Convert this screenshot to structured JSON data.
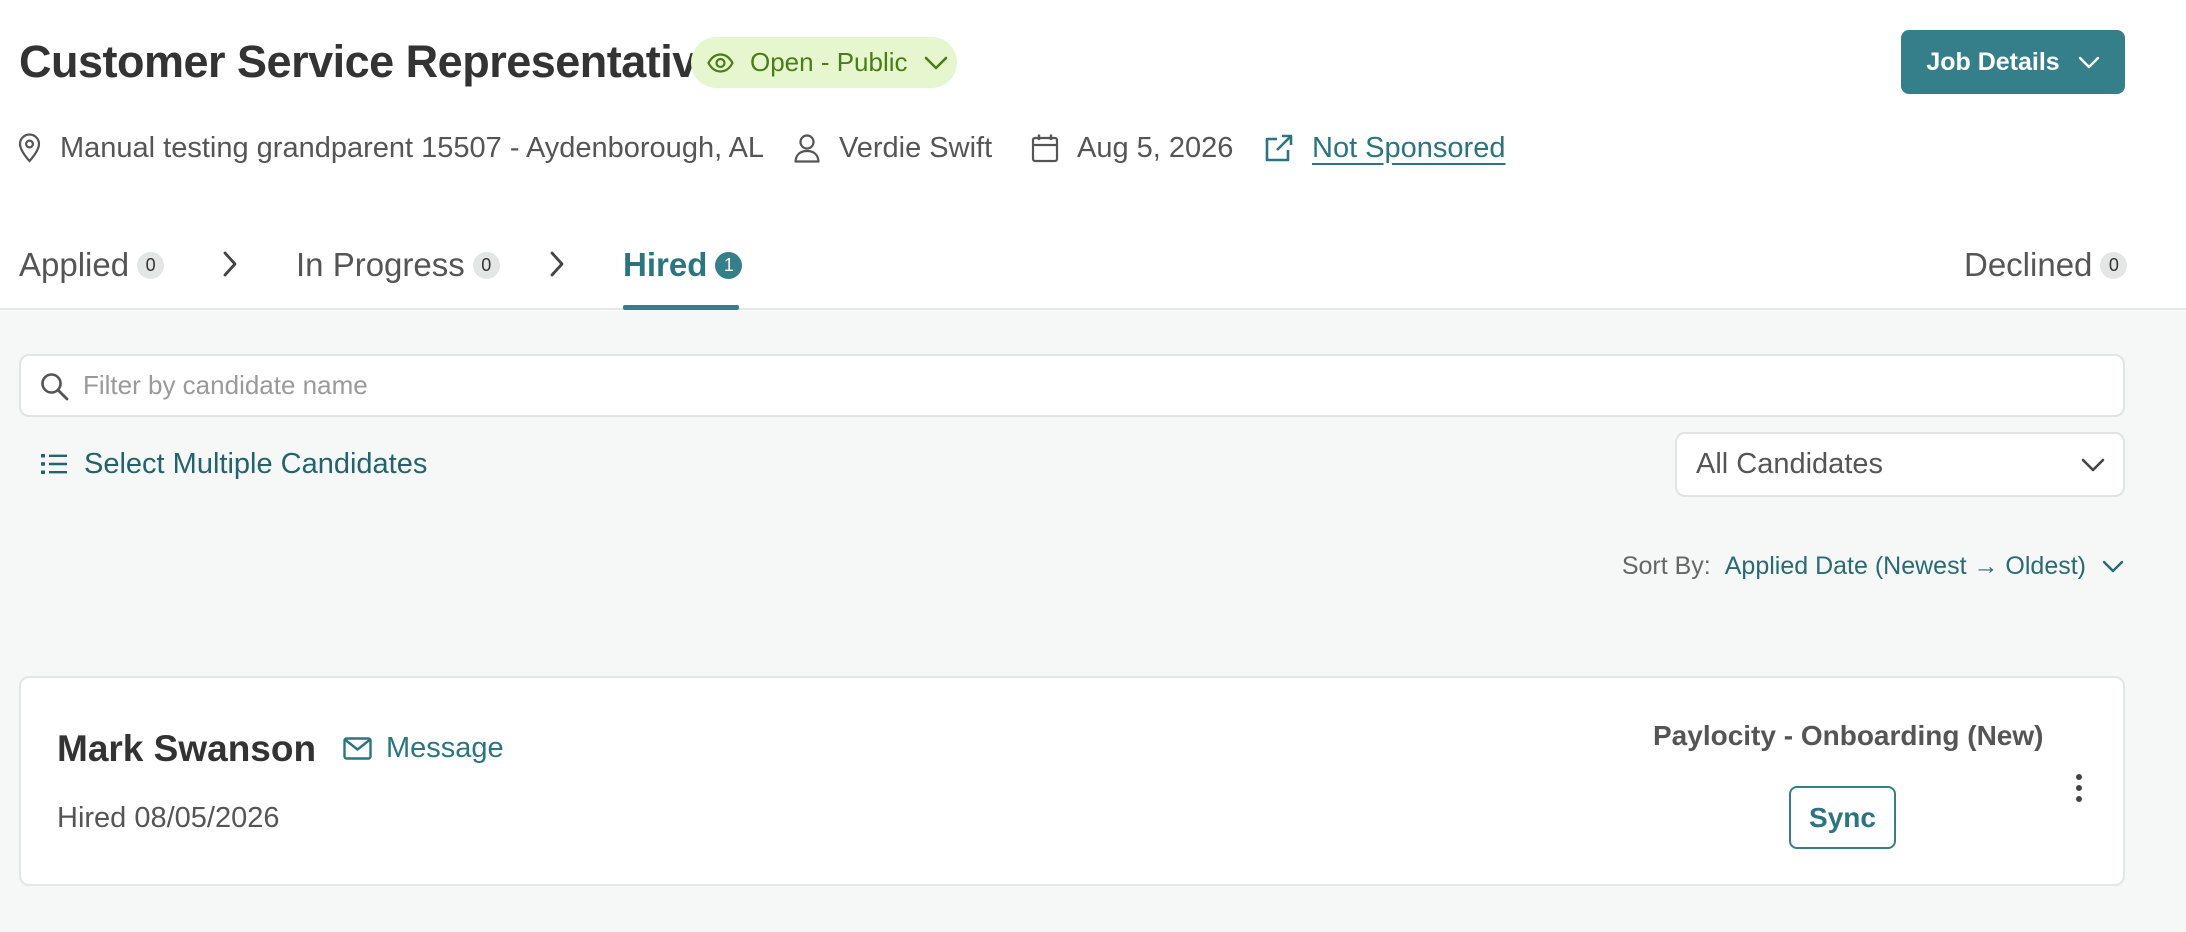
{
  "job": {
    "title": "Customer Service Representative",
    "status": "Open - Public",
    "details_button": "Job Details",
    "location": "Manual testing grandparent 15507 - Aydenborough, AL",
    "recruiter": "Verdie Swift",
    "date": "Aug 5, 2026",
    "sponsorship": "Not Sponsored"
  },
  "tabs": [
    {
      "label": "Applied",
      "count": "0"
    },
    {
      "label": "In Progress",
      "count": "0"
    },
    {
      "label": "Hired",
      "count": "1",
      "active": true
    },
    {
      "label": "Declined",
      "count": "0"
    }
  ],
  "filter": {
    "placeholder": "Filter by candidate name"
  },
  "select_multiple": "Select Multiple Candidates",
  "candidate_filter": {
    "selected": "All Candidates"
  },
  "sort": {
    "label": "Sort By:",
    "value": "Applied Date (Newest → Oldest)"
  },
  "candidates": [
    {
      "name": "Mark Swanson",
      "message_label": "Message",
      "hired": "Hired 08/05/2026",
      "integration": "Paylocity - Onboarding (New)",
      "action": "Sync"
    }
  ],
  "colors": {
    "accent": "#357f8a",
    "link": "#2a7580",
    "status_bg": "#e6f6cf",
    "status_text": "#4a7d16",
    "content_bg": "#f6f8f7"
  },
  "icons": [
    "eye-icon",
    "chevron-down-icon",
    "location-pin-icon",
    "person-icon",
    "calendar-icon",
    "external-link-icon",
    "chevron-right-icon",
    "search-icon",
    "list-icon",
    "envelope-icon",
    "kebab-menu-icon"
  ]
}
